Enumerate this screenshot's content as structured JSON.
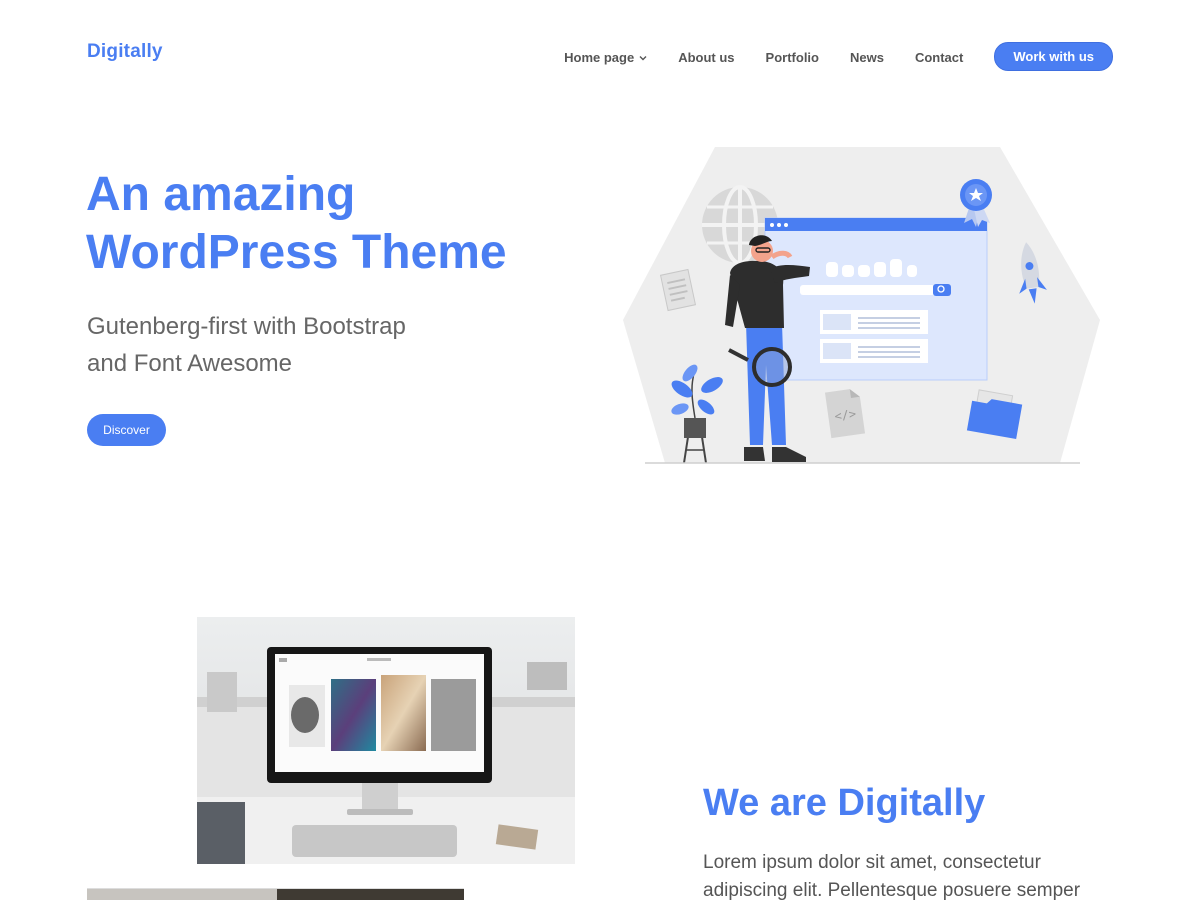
{
  "header": {
    "logo": "Digitally",
    "nav": {
      "home": "Home page",
      "about": "About us",
      "portfolio": "Portfolio",
      "news": "News",
      "contact": "Contact"
    },
    "cta_label": "Work with us"
  },
  "hero": {
    "title_line1": "An amazing",
    "title_line2": "WordPress Theme",
    "subtitle_line1": "Gutenberg-first with Bootstrap",
    "subtitle_line2": "and Font Awesome",
    "button_label": "Discover"
  },
  "about": {
    "title": "We are Digitally",
    "text_line1": "Lorem ipsum dolor sit amet, consectetur",
    "text_line2": "adipiscing elit. Pellentesque posuere semper"
  },
  "colors": {
    "accent": "#4a7ef2",
    "text": "#555555",
    "illustration_gray": "#eeeeee"
  },
  "icons": [
    "chevron-down-icon",
    "globe-icon",
    "award-badge-icon",
    "rocket-icon",
    "document-icon",
    "code-file-icon",
    "folder-icon",
    "magnifier-icon",
    "plant-icon"
  ]
}
